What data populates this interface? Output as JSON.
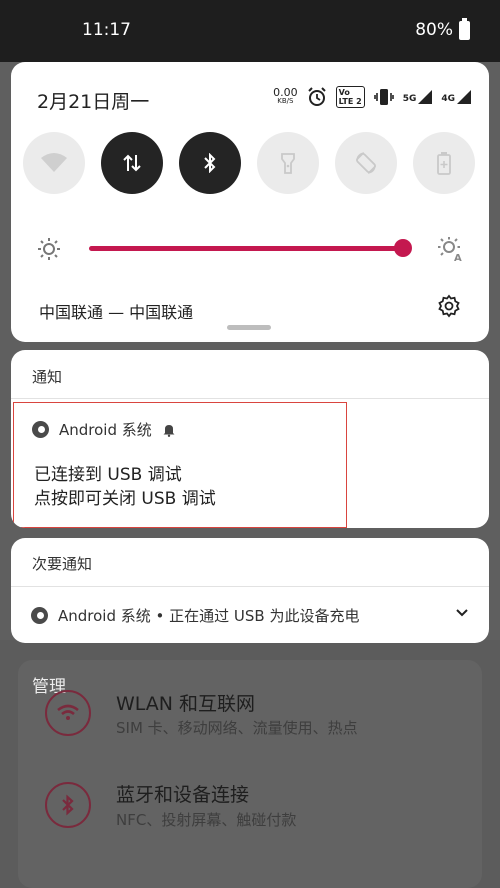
{
  "status_bar": {
    "time": "11:17",
    "battery": "80%"
  },
  "quick_settings": {
    "date": "2月21日周一",
    "net_speed_value": "0.00",
    "net_speed_unit": "KB/S",
    "signal_5g": "5G",
    "signal_4g": "4G",
    "lte_badge_top": "Vo",
    "lte_badge_bottom": "LTE 2",
    "carrier": "中国联通 — 中国联通",
    "brightness_level": 0.93,
    "tiles": [
      {
        "name": "wifi",
        "active": false
      },
      {
        "name": "mobile-data",
        "active": true
      },
      {
        "name": "bluetooth",
        "active": true
      },
      {
        "name": "flashlight",
        "active": false
      },
      {
        "name": "auto-rotate",
        "active": false
      },
      {
        "name": "battery-saver",
        "active": false
      }
    ]
  },
  "notifications": {
    "header": "通知",
    "item": {
      "app": "Android 系统",
      "line1": "已连接到 USB 调试",
      "line2": "点按即可关闭 USB 调试"
    }
  },
  "secondary": {
    "header": "次要通知",
    "item": "Android 系统 • 正在通过 USB 为此设备充电"
  },
  "background_settings": {
    "section": "管理",
    "rows": [
      {
        "title": "WLAN 和互联网",
        "subtitle": "SIM 卡、移动网络、流量使用、热点"
      },
      {
        "title": "蓝牙和设备连接",
        "subtitle": "NFC、投射屏幕、触碰付款"
      }
    ]
  },
  "colors": {
    "accent": "#c4184f",
    "highlight_box": "#d9453f"
  }
}
